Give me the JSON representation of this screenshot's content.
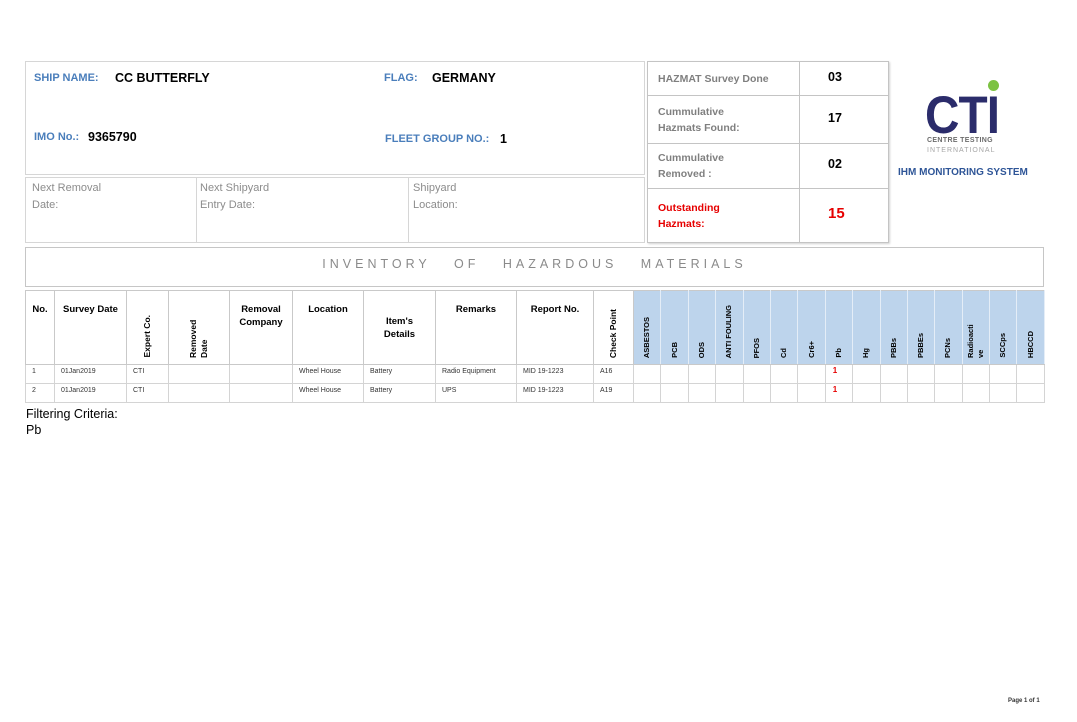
{
  "ship_info": {
    "ship_name_label": "SHIP NAME:",
    "ship_name": "CC BUTTERFLY",
    "flag_label": "FLAG:",
    "flag": "GERMANY",
    "imo_label": "IMO No.:",
    "imo": "9365790",
    "fleet_group_label": "FLEET GROUP NO.:",
    "fleet_group": "1"
  },
  "schedule": {
    "next_removal_label": "Next Removal Date:",
    "next_shipyard_label": "Next Shipyard Entry Date:",
    "shipyard_location_label": "Shipyard Location:"
  },
  "summary": [
    {
      "label": "HAZMAT Survey Done",
      "value": "03"
    },
    {
      "label": "Cummulative Hazmats Found:",
      "value": "17"
    },
    {
      "label": "Cummulative Removed :",
      "value": "02"
    },
    {
      "label": "Outstanding Hazmats:",
      "value": "15"
    }
  ],
  "logo": {
    "mark": "CTI",
    "line1": "CENTRE TESTING",
    "line2": "INTERNATIONAL",
    "system_name": "IHM MONITORING SYSTEM"
  },
  "report_title": "INVENTORY OF HAZARDOUS MATERIALS",
  "table": {
    "headers": {
      "no": "No.",
      "survey_date": "Survey Date",
      "expert_co": "Expert Co.",
      "removed_date": "Removed Date",
      "removal_company": "Removal Company",
      "location": "Location",
      "item_details": "Item's Details",
      "remarks": "Remarks",
      "report_no": "Report No.",
      "check_point": "Check Point"
    },
    "hazmat_headers": [
      "ASBESTOS",
      "PCB",
      "ODS",
      "ANTI FOULING",
      "PFOS",
      "Cd",
      "Cr6+",
      "Pb",
      "Hg",
      "PBBs",
      "PBBEs",
      "PCNs",
      "Radioactive",
      "SCCps",
      "HBCCD"
    ],
    "rows": [
      {
        "no": "1",
        "survey_date": "01Jan2019",
        "expert_co": "CTI",
        "location": "Wheel House",
        "item_details": "Battery",
        "remarks": "Radio Equipment",
        "report_no": "MID 19-1223",
        "check_point": "A16",
        "hazmat": {
          "Pb": "1"
        }
      },
      {
        "no": "2",
        "survey_date": "01Jan2019",
        "expert_co": "CTI",
        "location": "Wheel House",
        "item_details": "Battery",
        "remarks": "UPS",
        "report_no": "MID 19-1223",
        "check_point": "A19",
        "hazmat": {
          "Pb": "1"
        }
      }
    ]
  },
  "filter": {
    "label": "Filtering Criteria:",
    "value": "Pb"
  },
  "footer": {
    "page_label": "Page 1 of 1"
  },
  "colors": {
    "label_blue": "#4a7ebb",
    "label_gray": "#8c8c8c",
    "alert_red": "#e60000",
    "logo_navy": "#2b2c6b",
    "logo_green": "#7cc242",
    "system_blue": "#2e5597",
    "hazmat_header_bg": "#bdd4ec"
  }
}
